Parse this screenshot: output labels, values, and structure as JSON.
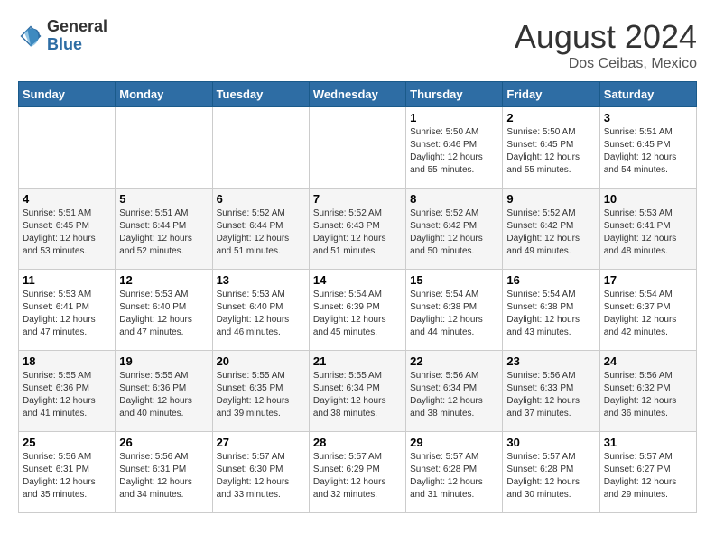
{
  "header": {
    "logo_general": "General",
    "logo_blue": "Blue",
    "month_year": "August 2024",
    "location": "Dos Ceibas, Mexico"
  },
  "days_of_week": [
    "Sunday",
    "Monday",
    "Tuesday",
    "Wednesday",
    "Thursday",
    "Friday",
    "Saturday"
  ],
  "weeks": [
    [
      {
        "day": "",
        "info": ""
      },
      {
        "day": "",
        "info": ""
      },
      {
        "day": "",
        "info": ""
      },
      {
        "day": "",
        "info": ""
      },
      {
        "day": "1",
        "info": "Sunrise: 5:50 AM\nSunset: 6:46 PM\nDaylight: 12 hours\nand 55 minutes."
      },
      {
        "day": "2",
        "info": "Sunrise: 5:50 AM\nSunset: 6:45 PM\nDaylight: 12 hours\nand 55 minutes."
      },
      {
        "day": "3",
        "info": "Sunrise: 5:51 AM\nSunset: 6:45 PM\nDaylight: 12 hours\nand 54 minutes."
      }
    ],
    [
      {
        "day": "4",
        "info": "Sunrise: 5:51 AM\nSunset: 6:45 PM\nDaylight: 12 hours\nand 53 minutes."
      },
      {
        "day": "5",
        "info": "Sunrise: 5:51 AM\nSunset: 6:44 PM\nDaylight: 12 hours\nand 52 minutes."
      },
      {
        "day": "6",
        "info": "Sunrise: 5:52 AM\nSunset: 6:44 PM\nDaylight: 12 hours\nand 51 minutes."
      },
      {
        "day": "7",
        "info": "Sunrise: 5:52 AM\nSunset: 6:43 PM\nDaylight: 12 hours\nand 51 minutes."
      },
      {
        "day": "8",
        "info": "Sunrise: 5:52 AM\nSunset: 6:42 PM\nDaylight: 12 hours\nand 50 minutes."
      },
      {
        "day": "9",
        "info": "Sunrise: 5:52 AM\nSunset: 6:42 PM\nDaylight: 12 hours\nand 49 minutes."
      },
      {
        "day": "10",
        "info": "Sunrise: 5:53 AM\nSunset: 6:41 PM\nDaylight: 12 hours\nand 48 minutes."
      }
    ],
    [
      {
        "day": "11",
        "info": "Sunrise: 5:53 AM\nSunset: 6:41 PM\nDaylight: 12 hours\nand 47 minutes."
      },
      {
        "day": "12",
        "info": "Sunrise: 5:53 AM\nSunset: 6:40 PM\nDaylight: 12 hours\nand 47 minutes."
      },
      {
        "day": "13",
        "info": "Sunrise: 5:53 AM\nSunset: 6:40 PM\nDaylight: 12 hours\nand 46 minutes."
      },
      {
        "day": "14",
        "info": "Sunrise: 5:54 AM\nSunset: 6:39 PM\nDaylight: 12 hours\nand 45 minutes."
      },
      {
        "day": "15",
        "info": "Sunrise: 5:54 AM\nSunset: 6:38 PM\nDaylight: 12 hours\nand 44 minutes."
      },
      {
        "day": "16",
        "info": "Sunrise: 5:54 AM\nSunset: 6:38 PM\nDaylight: 12 hours\nand 43 minutes."
      },
      {
        "day": "17",
        "info": "Sunrise: 5:54 AM\nSunset: 6:37 PM\nDaylight: 12 hours\nand 42 minutes."
      }
    ],
    [
      {
        "day": "18",
        "info": "Sunrise: 5:55 AM\nSunset: 6:36 PM\nDaylight: 12 hours\nand 41 minutes."
      },
      {
        "day": "19",
        "info": "Sunrise: 5:55 AM\nSunset: 6:36 PM\nDaylight: 12 hours\nand 40 minutes."
      },
      {
        "day": "20",
        "info": "Sunrise: 5:55 AM\nSunset: 6:35 PM\nDaylight: 12 hours\nand 39 minutes."
      },
      {
        "day": "21",
        "info": "Sunrise: 5:55 AM\nSunset: 6:34 PM\nDaylight: 12 hours\nand 38 minutes."
      },
      {
        "day": "22",
        "info": "Sunrise: 5:56 AM\nSunset: 6:34 PM\nDaylight: 12 hours\nand 38 minutes."
      },
      {
        "day": "23",
        "info": "Sunrise: 5:56 AM\nSunset: 6:33 PM\nDaylight: 12 hours\nand 37 minutes."
      },
      {
        "day": "24",
        "info": "Sunrise: 5:56 AM\nSunset: 6:32 PM\nDaylight: 12 hours\nand 36 minutes."
      }
    ],
    [
      {
        "day": "25",
        "info": "Sunrise: 5:56 AM\nSunset: 6:31 PM\nDaylight: 12 hours\nand 35 minutes."
      },
      {
        "day": "26",
        "info": "Sunrise: 5:56 AM\nSunset: 6:31 PM\nDaylight: 12 hours\nand 34 minutes."
      },
      {
        "day": "27",
        "info": "Sunrise: 5:57 AM\nSunset: 6:30 PM\nDaylight: 12 hours\nand 33 minutes."
      },
      {
        "day": "28",
        "info": "Sunrise: 5:57 AM\nSunset: 6:29 PM\nDaylight: 12 hours\nand 32 minutes."
      },
      {
        "day": "29",
        "info": "Sunrise: 5:57 AM\nSunset: 6:28 PM\nDaylight: 12 hours\nand 31 minutes."
      },
      {
        "day": "30",
        "info": "Sunrise: 5:57 AM\nSunset: 6:28 PM\nDaylight: 12 hours\nand 30 minutes."
      },
      {
        "day": "31",
        "info": "Sunrise: 5:57 AM\nSunset: 6:27 PM\nDaylight: 12 hours\nand 29 minutes."
      }
    ]
  ]
}
